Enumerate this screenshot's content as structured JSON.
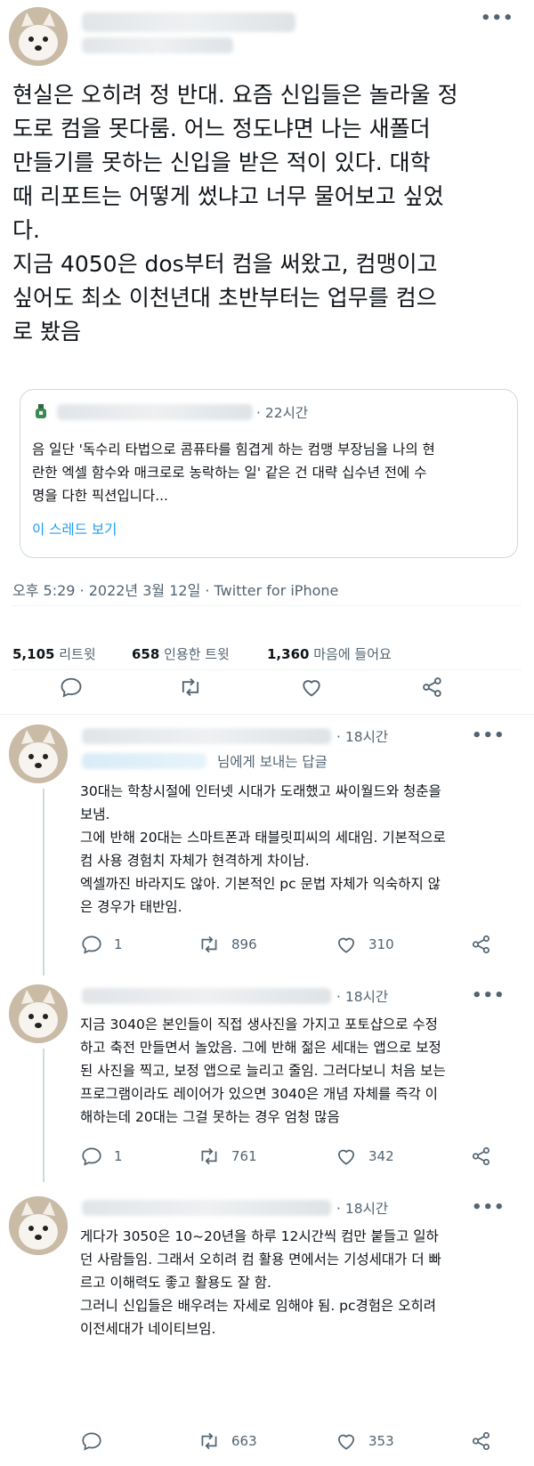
{
  "main_tweet": {
    "text": "현실은 오히려 정 반대. 요즘 신입들은 놀라울 정\n도로 컴을 못다룸. 어느 정도냐면 나는 새폴더\n만들기를 못하는 신입을 받은 적이 있다. 대학\n때 리포트는 어떻게 썼냐고 너무 물어보고 싶었\n다.\n지금 4050은 dos부터 컴을 써왔고, 컴맹이고\n싶어도 최소 이천년대 초반부터는 업무를 컴으\n로 봤음",
    "quoted": {
      "time": "· 22시간",
      "text": "음 일단 '독수리 타법으로 콤퓨타를 힘겹게 하는 컴맹 부장님을 나의 현\n란한 엑셀 함수와 매크로로 농락하는 일' 같은 건 대략 십수년 전에 수\n명을 다한 픽션입니다...",
      "link": "이 스레드 보기"
    },
    "meta": "오후 5:29 · 2022년 3월 12일 · Twitter for iPhone",
    "stats": {
      "retweets_count": "5,105",
      "retweets_label": "리트윗",
      "quotes_count": "658",
      "quotes_label": "인용한 트윗",
      "likes_count": "1,360",
      "likes_label": "마음에 들어요"
    }
  },
  "replies": [
    {
      "time": "· 18시간",
      "reply_to": "님에게 보내는 답글",
      "text": "30대는 학창시절에 인터넷 시대가 도래했고 싸이월드와 청춘을\n보냄.\n그에 반해 20대는 스마트폰과 태블릿피씨의 세대임. 기본적으로\n컴 사용 경험치 자체가 현격하게 차이남.\n엑셀까진 바라지도 않아. 기본적인 pc 문법 자체가 익숙하지 않\n은 경우가 태반임.",
      "replies": "1",
      "retweets": "896",
      "likes": "310"
    },
    {
      "time": "· 18시간",
      "text": "지금 3040은 본인들이 직접 생사진을 가지고 포토샵으로 수정\n하고 축전 만들면서 놀았음. 그에 반해 젊은 세대는 앱으로 보정\n된 사진을 찍고, 보정 앱으로 늘리고 줄임. 그러다보니 처음 보는\n프로그램이라도 레이어가 있으면 3040은 개념 자체를 즉각 이\n해하는데 20대는 그걸 못하는 경우 엄청 많음",
      "replies": "1",
      "retweets": "761",
      "likes": "342"
    },
    {
      "time": "· 18시간",
      "text": "게다가 3050은 10~20년을 하루 12시간씩 컴만 붙들고 일하\n던 사람들임. 그래서 오히려 컴 활용 면에서는 기성세대가 더 빠\n르고 이해력도 좋고 활용도 잘 함.\n그러니 신입들은 배우려는 자세로 임해야 됨. pc경험은 오히려\n이전세대가 네이티브임.",
      "retweets": "663",
      "likes": "353"
    }
  ],
  "colors": {
    "accent": "#1d9bf0",
    "muted": "#536471",
    "border": "#cfd9de"
  },
  "icons": [
    "reply-icon",
    "retweet-icon",
    "like-icon",
    "share-icon",
    "more-icon",
    "dog-avatar"
  ]
}
